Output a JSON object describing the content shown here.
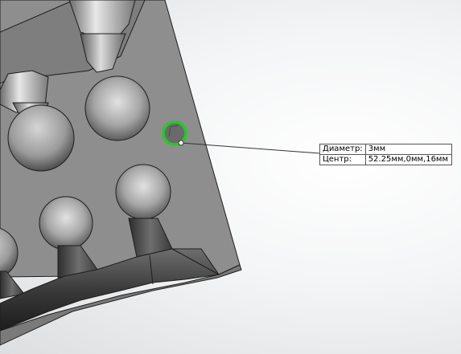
{
  "measurement": {
    "diameter_label": "Диаметр:",
    "diameter_value": "3мм",
    "center_label": "Центр:",
    "center_value": "52.25мм,0мм,16мм"
  },
  "colors": {
    "selection": "#22cc22",
    "part_face": "#8e8e8e",
    "part_edge": "#1e1e1e",
    "background": "#f4f5f6"
  }
}
